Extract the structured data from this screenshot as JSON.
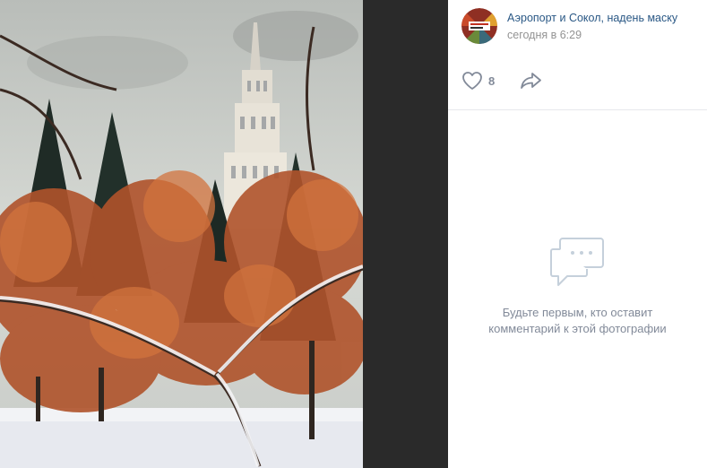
{
  "post": {
    "author_name": "Аэропорт и Сокол, надень маску",
    "time": "сегодня в 6:29",
    "avatar_icon": "community-avatar-logo"
  },
  "actions": {
    "likes_count": "8",
    "like_icon": "heart-icon",
    "share_icon": "share-arrow-icon"
  },
  "comments": {
    "empty_line1": "Будьте первым, кто оставит",
    "empty_line2": "комментарий к этой фотографии",
    "empty_icon": "comments-bubble-icon"
  },
  "colors": {
    "author_link": "#2a5885",
    "muted_text": "#828a99",
    "viewer_background": "#2a2a2a"
  }
}
